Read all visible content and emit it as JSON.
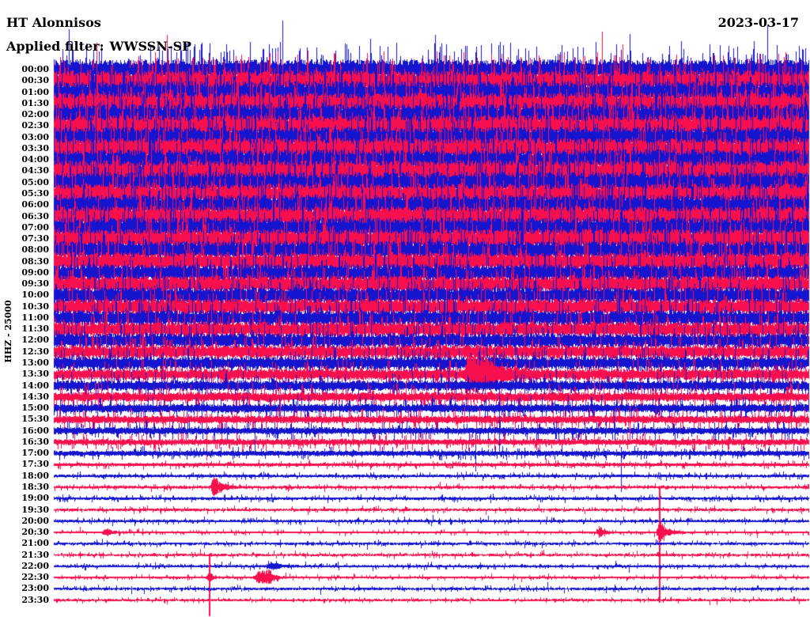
{
  "header": {
    "station_title": "HT Alonnisos",
    "date": "2023-03-17",
    "filter_prefix": "Applied filter:",
    "filter_value": "WWSSN-SP"
  },
  "axis": {
    "stream_scale_label": "HHZ - 25000"
  },
  "chart_data": {
    "type": "line",
    "subtype": "helicorder-seismogram",
    "title": "HT Alonnisos",
    "subtitle": "Applied filter: WWSSN-SP",
    "date_label": "2023-03-17",
    "y_axis_label": "HHZ - 25000",
    "row_interval_minutes": 30,
    "rows_per_day": 48,
    "amplitude_units": "px_half_band",
    "trace_colors": {
      "blue": "#1515d0",
      "red": "#f8104e"
    },
    "legend": "even half-hours blue, odd half-hours red; noise amplitude decays from 00:00 (strong microseism) to 23:30 (quiet)",
    "rows": [
      {
        "t": "00:00",
        "c": "blue",
        "a": 13
      },
      {
        "t": "00:30",
        "c": "red",
        "a": 13.5
      },
      {
        "t": "01:00",
        "c": "blue",
        "a": 14
      },
      {
        "t": "01:30",
        "c": "red",
        "a": 14
      },
      {
        "t": "02:00",
        "c": "blue",
        "a": 14
      },
      {
        "t": "02:30",
        "c": "red",
        "a": 14
      },
      {
        "t": "03:00",
        "c": "blue",
        "a": 13.5
      },
      {
        "t": "03:30",
        "c": "red",
        "a": 13.5
      },
      {
        "t": "04:00",
        "c": "blue",
        "a": 13.5
      },
      {
        "t": "04:30",
        "c": "red",
        "a": 14
      },
      {
        "t": "05:00",
        "c": "blue",
        "a": 13.5
      },
      {
        "t": "05:30",
        "c": "red",
        "a": 13
      },
      {
        "t": "06:00",
        "c": "blue",
        "a": 13
      },
      {
        "t": "06:30",
        "c": "red",
        "a": 13
      },
      {
        "t": "07:00",
        "c": "blue",
        "a": 13
      },
      {
        "t": "07:30",
        "c": "red",
        "a": 12.5
      },
      {
        "t": "08:00",
        "c": "blue",
        "a": 12
      },
      {
        "t": "08:30",
        "c": "red",
        "a": 11.5
      },
      {
        "t": "09:00",
        "c": "blue",
        "a": 11
      },
      {
        "t": "09:30",
        "c": "red",
        "a": 11
      },
      {
        "t": "10:00",
        "c": "blue",
        "a": 10.5
      },
      {
        "t": "10:30",
        "c": "red",
        "a": 10
      },
      {
        "t": "11:00",
        "c": "blue",
        "a": 10
      },
      {
        "t": "11:30",
        "c": "red",
        "a": 9.5
      },
      {
        "t": "12:00",
        "c": "blue",
        "a": 9
      },
      {
        "t": "12:30",
        "c": "red",
        "a": 8.5
      },
      {
        "t": "13:00",
        "c": "blue",
        "a": 8
      },
      {
        "t": "13:30",
        "c": "red",
        "a": 7,
        "ev": [
          {
            "f": 0.547,
            "a": 22,
            "p": 22,
            "d": 20,
            "att": 3,
            "note": "large tapered earthquake burst"
          }
        ]
      },
      {
        "t": "14:00",
        "c": "blue",
        "a": 6.5
      },
      {
        "t": "14:30",
        "c": "red",
        "a": 6
      },
      {
        "t": "15:00",
        "c": "blue",
        "a": 5.5
      },
      {
        "t": "15:30",
        "c": "red",
        "a": 5
      },
      {
        "t": "16:00",
        "c": "blue",
        "a": 4.5
      },
      {
        "t": "16:30",
        "c": "red",
        "a": 4
      },
      {
        "t": "17:00",
        "c": "blue",
        "a": 3.5
      },
      {
        "t": "17:30",
        "c": "red",
        "a": 2.2
      },
      {
        "t": "18:00",
        "c": "blue",
        "a": 1.9
      },
      {
        "t": "18:30",
        "c": "red",
        "a": 1.8,
        "ev": [
          {
            "f": 0.21,
            "a": 11,
            "p": 4,
            "d": 9,
            "att": 2,
            "note": "small local event"
          }
        ]
      },
      {
        "t": "19:00",
        "c": "blue",
        "a": 1.9
      },
      {
        "t": "19:30",
        "c": "red",
        "a": 1.6
      },
      {
        "t": "20:00",
        "c": "blue",
        "a": 1.8
      },
      {
        "t": "20:30",
        "c": "red",
        "a": 1.5,
        "ev": [
          {
            "f": 0.068,
            "a": 4,
            "p": 4,
            "d": 5
          },
          {
            "f": 0.722,
            "a": 6,
            "p": 2,
            "d": 5
          },
          {
            "f": 0.802,
            "a": 13,
            "p": 3,
            "d": 8
          },
          {
            "f": 0.802,
            "up": 56,
            "dn": 89,
            "note": "clipped spike crossing rows"
          }
        ]
      },
      {
        "t": "21:00",
        "c": "blue",
        "a": 1.6
      },
      {
        "t": "21:30",
        "c": "red",
        "a": 1.5
      },
      {
        "t": "22:00",
        "c": "blue",
        "a": 1.7,
        "ev": [
          {
            "f": 0.285,
            "a": 3,
            "p": 10,
            "d": 8,
            "att": 6
          }
        ]
      },
      {
        "t": "22:30",
        "c": "red",
        "a": 1.5,
        "ev": [
          {
            "f": 0.205,
            "a": 6,
            "p": 1,
            "d": 4
          },
          {
            "f": 0.205,
            "up": 29,
            "dn": 49,
            "note": "clipped spike to bottom edge"
          },
          {
            "f": 0.272,
            "a": 8,
            "p": 14,
            "d": 6,
            "att": 8
          }
        ]
      },
      {
        "t": "23:00",
        "c": "blue",
        "a": 1.6
      },
      {
        "t": "23:30",
        "c": "red",
        "a": 1.5
      }
    ]
  }
}
